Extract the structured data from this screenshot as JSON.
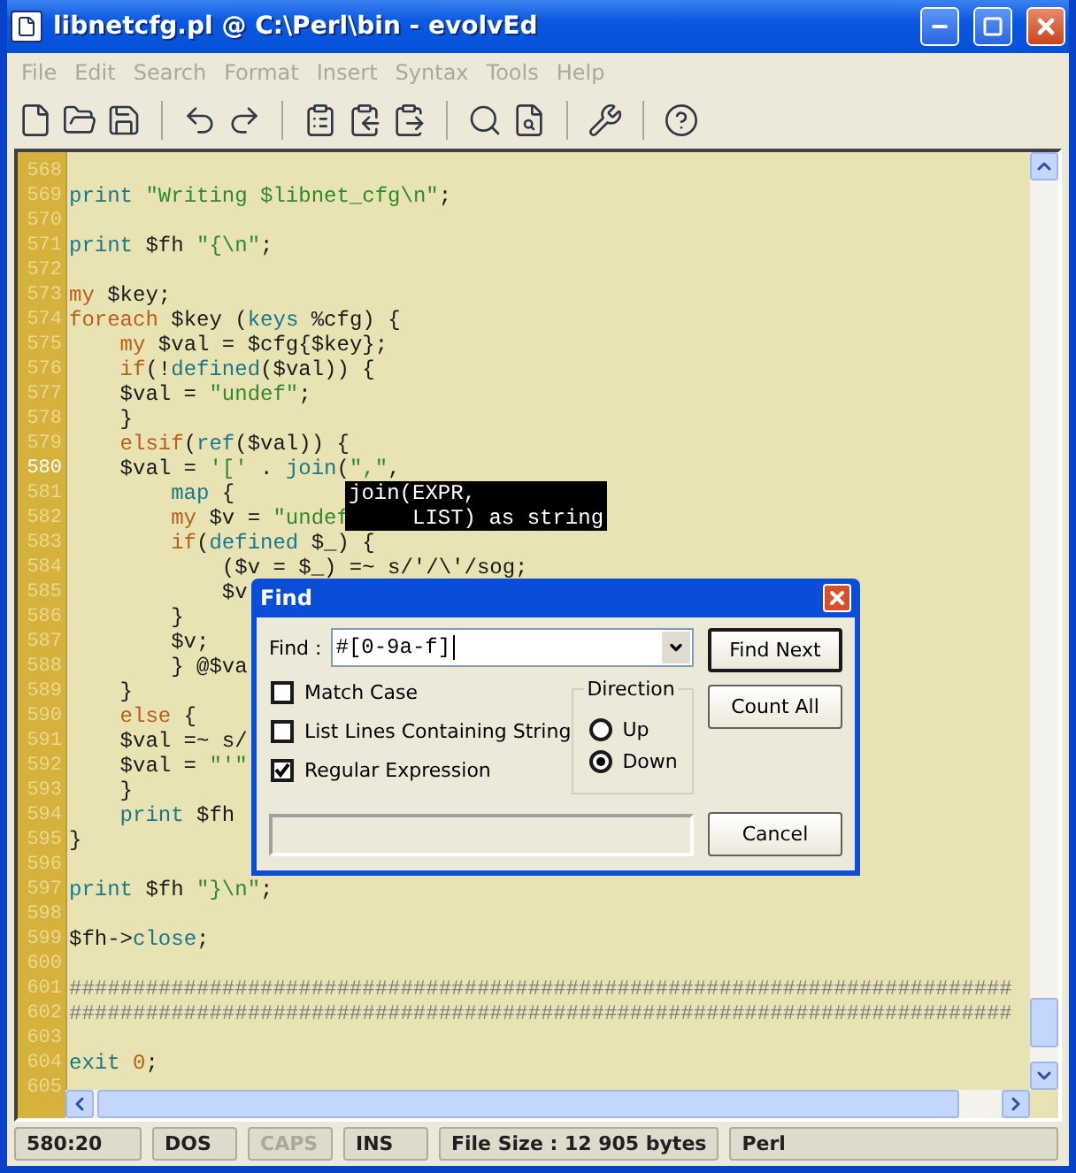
{
  "window": {
    "title": "libnetcfg.pl @ C:\\Perl\\bin - evolvEd"
  },
  "menu": [
    {
      "label": "File",
      "disabled": true
    },
    {
      "label": "Edit",
      "disabled": true
    },
    {
      "label": "Search",
      "disabled": true
    },
    {
      "label": "Format",
      "disabled": true
    },
    {
      "label": "Insert",
      "disabled": true
    },
    {
      "label": "Syntax",
      "disabled": true
    },
    {
      "label": "Tools",
      "disabled": true
    },
    {
      "label": "Help",
      "disabled": true
    }
  ],
  "editor": {
    "lines": [
      {
        "number": "568",
        "current": false
      },
      {
        "number": "569",
        "current": false,
        "tokens": [
          {
            "kind": "builtin",
            "text": "print"
          },
          {
            "kind": "string",
            "text": " \"Writing $libnet_cfg\\n\""
          },
          {
            "kind": "plain",
            "text": ";"
          }
        ]
      },
      {
        "number": "570",
        "current": false
      },
      {
        "number": "571",
        "current": false,
        "tokens": [
          {
            "kind": "builtin",
            "text": "print"
          },
          {
            "kind": "plain",
            "text": " $fh "
          },
          {
            "kind": "string",
            "text": "\"{\\n\""
          },
          {
            "kind": "plain",
            "text": ";"
          }
        ]
      },
      {
        "number": "572",
        "current": false
      },
      {
        "number": "573",
        "current": false,
        "tokens": [
          {
            "kind": "keyword",
            "text": "my"
          },
          {
            "kind": "plain",
            "text": " $key;"
          }
        ]
      },
      {
        "number": "574",
        "current": false,
        "tokens": [
          {
            "kind": "keyword",
            "text": "foreach"
          },
          {
            "kind": "plain",
            "text": " $key ("
          },
          {
            "kind": "builtin",
            "text": "keys"
          },
          {
            "kind": "plain",
            "text": " %cfg) {"
          }
        ]
      },
      {
        "number": "575",
        "current": false,
        "tokens": [
          {
            "kind": "keyword",
            "text": "    my"
          },
          {
            "kind": "plain",
            "text": " $val = $cfg{$key};"
          }
        ]
      },
      {
        "number": "576",
        "current": false,
        "tokens": [
          {
            "kind": "keyword",
            "text": "    if"
          },
          {
            "kind": "plain",
            "text": "(!"
          },
          {
            "kind": "builtin",
            "text": "defined"
          },
          {
            "kind": "plain",
            "text": "($val)) {"
          }
        ]
      },
      {
        "number": "577",
        "current": false,
        "tokens": [
          {
            "kind": "plain",
            "text": "    $val = "
          },
          {
            "kind": "string",
            "text": "\"undef\""
          },
          {
            "kind": "plain",
            "text": ";"
          }
        ]
      },
      {
        "number": "578",
        "current": false,
        "tokens": [
          {
            "kind": "plain",
            "text": "    }"
          }
        ]
      },
      {
        "number": "579",
        "current": false,
        "tokens": [
          {
            "kind": "keyword",
            "text": "    elsif"
          },
          {
            "kind": "plain",
            "text": "("
          },
          {
            "kind": "builtin",
            "text": "ref"
          },
          {
            "kind": "plain",
            "text": "($val)) {"
          }
        ]
      },
      {
        "number": "580",
        "current": true,
        "tokens": [
          {
            "kind": "plain",
            "text": "    $val = "
          },
          {
            "kind": "string",
            "text": "'['"
          },
          {
            "kind": "plain",
            "text": " . "
          },
          {
            "kind": "builtin",
            "text": "join"
          },
          {
            "kind": "plain",
            "text": "("
          },
          {
            "kind": "string",
            "text": "\",\""
          },
          {
            "kind": "plain",
            "text": ","
          }
        ]
      },
      {
        "number": "581",
        "current": false,
        "tokens": [
          {
            "kind": "builtin",
            "text": "        map"
          },
          {
            "kind": "plain",
            "text": " {"
          }
        ]
      },
      {
        "number": "582",
        "current": false,
        "tokens": [
          {
            "kind": "keyword",
            "text": "        my"
          },
          {
            "kind": "plain",
            "text": " $v = "
          },
          {
            "kind": "string",
            "text": "\"undef"
          }
        ]
      },
      {
        "number": "583",
        "current": false,
        "tokens": [
          {
            "kind": "keyword",
            "text": "        if"
          },
          {
            "kind": "plain",
            "text": "("
          },
          {
            "kind": "builtin",
            "text": "defined"
          },
          {
            "kind": "plain",
            "text": " $_) {"
          }
        ]
      },
      {
        "number": "584",
        "current": false,
        "tokens": [
          {
            "kind": "plain",
            "text": "            ($v = $_) =~ s/'/\\'/sog;"
          }
        ]
      },
      {
        "number": "585",
        "current": false,
        "tokens": [
          {
            "kind": "plain",
            "text": "            $v"
          }
        ]
      },
      {
        "number": "586",
        "current": false,
        "tokens": [
          {
            "kind": "plain",
            "text": "        }"
          }
        ]
      },
      {
        "number": "587",
        "current": false,
        "tokens": [
          {
            "kind": "plain",
            "text": "        $v;"
          }
        ]
      },
      {
        "number": "588",
        "current": false,
        "tokens": [
          {
            "kind": "plain",
            "text": "        } @$va"
          }
        ]
      },
      {
        "number": "589",
        "current": false,
        "tokens": [
          {
            "kind": "plain",
            "text": "    }"
          }
        ]
      },
      {
        "number": "590",
        "current": false,
        "tokens": [
          {
            "kind": "keyword",
            "text": "    else"
          },
          {
            "kind": "plain",
            "text": " {"
          }
        ]
      },
      {
        "number": "591",
        "current": false,
        "tokens": [
          {
            "kind": "plain",
            "text": "    $val =~ s/"
          }
        ]
      },
      {
        "number": "592",
        "current": false,
        "tokens": [
          {
            "kind": "plain",
            "text": "    $val = "
          },
          {
            "kind": "string",
            "text": "\"'\""
          }
        ]
      },
      {
        "number": "593",
        "current": false,
        "tokens": [
          {
            "kind": "plain",
            "text": "    }"
          }
        ]
      },
      {
        "number": "594",
        "current": false,
        "tokens": [
          {
            "kind": "builtin",
            "text": "    print"
          },
          {
            "kind": "plain",
            "text": " $fh"
          }
        ]
      },
      {
        "number": "595",
        "current": false,
        "tokens": [
          {
            "kind": "plain",
            "text": "}"
          }
        ]
      },
      {
        "number": "596",
        "current": false
      },
      {
        "number": "597",
        "current": false,
        "tokens": [
          {
            "kind": "builtin",
            "text": "print"
          },
          {
            "kind": "plain",
            "text": " $fh "
          },
          {
            "kind": "string",
            "text": "\"}\\n\""
          },
          {
            "kind": "plain",
            "text": ";"
          }
        ]
      },
      {
        "number": "598",
        "current": false
      },
      {
        "number": "599",
        "current": false,
        "tokens": [
          {
            "kind": "plain",
            "text": "$fh->"
          },
          {
            "kind": "builtin",
            "text": "close"
          },
          {
            "kind": "plain",
            "text": ";"
          }
        ]
      },
      {
        "number": "600",
        "current": false
      },
      {
        "number": "601",
        "current": false,
        "tokens": [
          {
            "kind": "comment",
            "text": "##########################################################################"
          }
        ]
      },
      {
        "number": "602",
        "current": false,
        "tokens": [
          {
            "kind": "comment",
            "text": "##########################################################################"
          }
        ]
      },
      {
        "number": "603",
        "current": false
      },
      {
        "number": "604",
        "current": false,
        "tokens": [
          {
            "kind": "builtin",
            "text": "exit"
          },
          {
            "kind": "number",
            "text": " 0"
          },
          {
            "kind": "plain",
            "text": ";"
          }
        ]
      },
      {
        "number": "605",
        "current": false
      }
    ],
    "tooltip": {
      "lines": [
        "join(EXPR,",
        "     LIST) as string"
      ]
    }
  },
  "find_dialog": {
    "title": "Find",
    "find_label": "Find :",
    "find_value": "#[0-9a-f]",
    "options": [
      {
        "label": "Match Case",
        "checked": false
      },
      {
        "label": "List Lines Containing String",
        "checked": false
      },
      {
        "label": "Regular Expression",
        "checked": true
      }
    ],
    "direction": {
      "label": "Direction",
      "options": [
        {
          "label": "Up",
          "selected": false
        },
        {
          "label": "Down",
          "selected": true
        }
      ]
    },
    "buttons": [
      {
        "label": "Find Next",
        "default": true
      },
      {
        "label": "Count All",
        "default": false
      },
      {
        "label": "Cancel",
        "default": false
      }
    ]
  },
  "status_bar": [
    {
      "text": "580:20",
      "disabled": false
    },
    {
      "text": "DOS",
      "disabled": false
    },
    {
      "text": "CAPS",
      "disabled": true
    },
    {
      "text": "INS",
      "disabled": false
    },
    {
      "text": "File Size : 12 905 bytes",
      "disabled": false
    },
    {
      "text": "Perl",
      "disabled": false
    }
  ]
}
